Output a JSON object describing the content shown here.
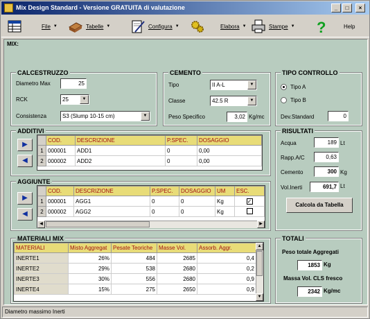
{
  "window": {
    "title": "Mix Design Standard - Versione GRATUITA di valutazione"
  },
  "toolbar": {
    "file": "File",
    "tabelle": "Tabelle",
    "configura": "Configura",
    "elabora": "Elabora",
    "stampe": "Stampe",
    "help": "Help"
  },
  "main": {
    "title": "MIX:"
  },
  "calcestruzzo": {
    "title": "CALCESTRUZZO",
    "diametro_label": "Diametro Max",
    "diametro_value": "25",
    "rck_label": "RCK",
    "rck_value": "25",
    "consistenza_label": "Consistenza",
    "consistenza_value": "S3 (Slump 10-15 cm)"
  },
  "cemento": {
    "title": "CEMENTO",
    "tipo_label": "Tipo",
    "tipo_value": "II A-L",
    "classe_label": "Classe",
    "classe_value": "42.5 R",
    "peso_label": "Peso Specifico",
    "peso_value": "3,02",
    "peso_unit": "Kg/mc"
  },
  "tipo_controllo": {
    "title": "TIPO CONTROLLO",
    "option_a": "Tipo A",
    "option_b": "Tipo B",
    "selected": "Tipo A",
    "devstd_label": "Dev.Standard",
    "devstd_value": "0"
  },
  "additivi": {
    "title": "ADDITIVI",
    "columns": [
      "COD.",
      "DESCRIZIONE",
      "P.SPEC.",
      "DOSAGGIO"
    ],
    "rows": [
      {
        "n": "1",
        "cod": "000001",
        "desc": "ADD1",
        "pspec": "0",
        "dos": "0,00"
      },
      {
        "n": "2",
        "cod": "000002",
        "desc": "ADD2",
        "pspec": "0",
        "dos": "0,00"
      }
    ]
  },
  "aggiunte": {
    "title": "AGGIUNTE",
    "columns": [
      "COD.",
      "DESCRIZIONE",
      "P.SPEC.",
      "DOSAGGIO",
      "UM",
      "ESC."
    ],
    "rows": [
      {
        "n": "1",
        "cod": "000001",
        "desc": "AGG1",
        "pspec": "0",
        "dos": "0",
        "um": "Kg",
        "esc": true
      },
      {
        "n": "2",
        "cod": "000002",
        "desc": "AGG2",
        "pspec": "0",
        "dos": "0",
        "um": "Kg",
        "esc": false
      }
    ]
  },
  "risultati": {
    "title": "RISULTATI",
    "acqua_label": "Acqua",
    "acqua_value": "189",
    "acqua_unit": "Lt",
    "rapp_label": "Rapp.A/C",
    "rapp_value": "0,63",
    "cemento_label": "Cemento",
    "cemento_value": "300",
    "cemento_unit": "Kg",
    "volinerti_label": "Vol.Inerti",
    "volinerti_value": "691,7",
    "volinerti_unit": "Lt",
    "calcola_button": "Calcola da Tabella"
  },
  "materiali": {
    "title": "MATERIALI MIX",
    "columns": [
      "MATERIALI",
      "Misto Aggregat",
      "Pesate Teoriche",
      "Masse Vol.",
      "Assorb. Aggr."
    ],
    "rows": [
      {
        "mat": "INERTE1",
        "misto": "26%",
        "pesate": "484",
        "masse": "2685",
        "assorb": "0,4"
      },
      {
        "mat": "INERTE2",
        "misto": "29%",
        "pesate": "538",
        "masse": "2680",
        "assorb": "0,2"
      },
      {
        "mat": "INERTE3",
        "misto": "30%",
        "pesate": "556",
        "masse": "2680",
        "assorb": "0,9"
      },
      {
        "mat": "INERTE4",
        "misto": "15%",
        "pesate": "275",
        "masse": "2650",
        "assorb": "0,9"
      }
    ]
  },
  "totali": {
    "title": "TOTALI",
    "peso_label": "Peso totale Aggregati",
    "peso_value": "1853",
    "peso_unit": "Kg",
    "massa_label": "Massa Vol. CLS fresco",
    "massa_value": "2342",
    "massa_unit": "Kg/mc"
  },
  "statusbar": {
    "text": "Diametro massimo Inerti"
  },
  "colors": {
    "title_start": "#0a246a",
    "title_end": "#a6caf0",
    "panel": "#b8ccbf",
    "grid_header": "#e8dc78",
    "grid_header_text": "#a01010",
    "nav_arrow": "#1030a0"
  }
}
